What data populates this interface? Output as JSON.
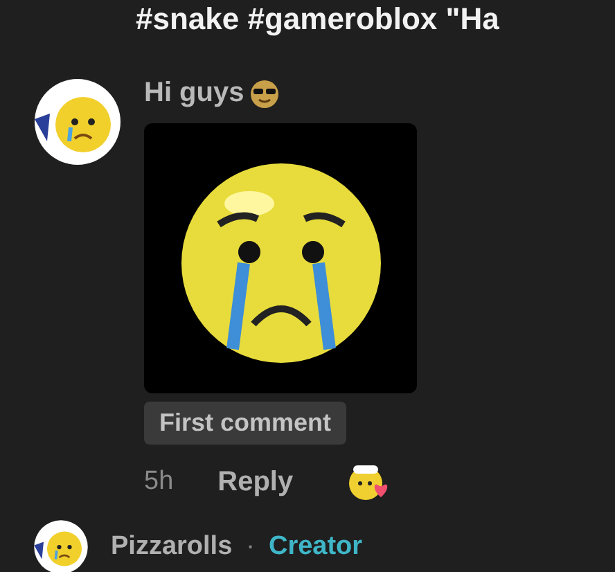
{
  "caption": "#snake #gameroblox \"Ha",
  "comments": [
    {
      "text": "Hi guys",
      "tag": "First comment",
      "time": "5h",
      "reply": "Reply"
    },
    {
      "author": "Pizzarolls",
      "separator": "·",
      "badge": "Creator"
    }
  ]
}
